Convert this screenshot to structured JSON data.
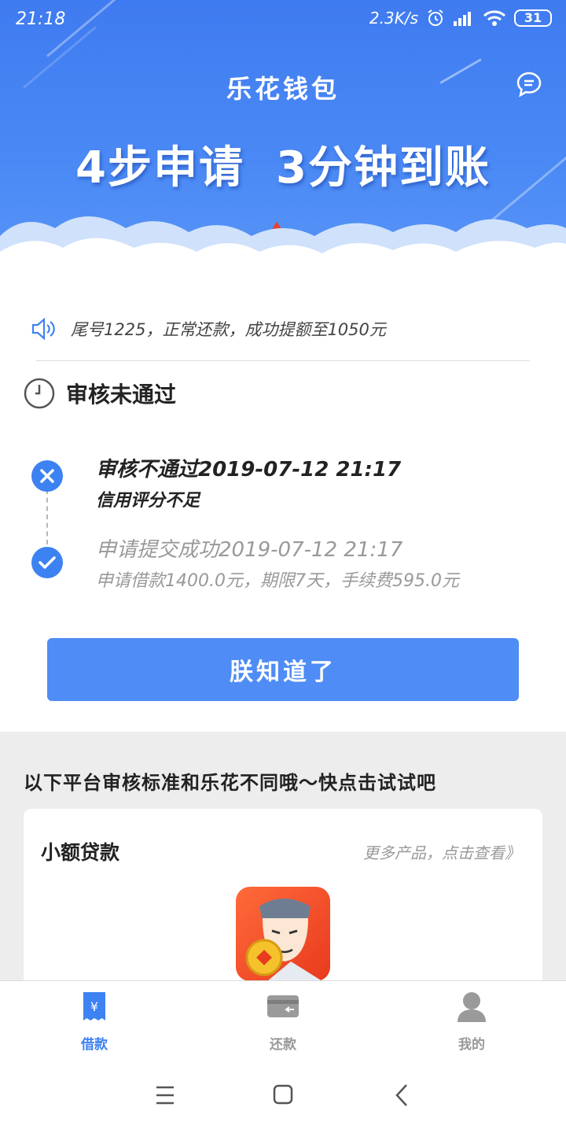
{
  "status_bar": {
    "time": "21:18",
    "speed": "2.3K/s",
    "battery": "31"
  },
  "header": {
    "app_title": "乐花钱包",
    "slogan_part1": "4步申请",
    "slogan_part2": "3分钟到账"
  },
  "notice": {
    "text": "尾号1225，正常还款，成功提额至1050元"
  },
  "review": {
    "title": "审核未通过",
    "steps": [
      {
        "title": "审核不通过2019-07-12  21:17",
        "subtitle": "信用评分不足"
      },
      {
        "title": "申请提交成功2019-07-12  21:17",
        "subtitle": "申请借款1400.0元，期限7天，手续费595.0元"
      }
    ]
  },
  "confirm_button": "朕知道了",
  "recommend": {
    "title": "以下平台审核标准和乐花不同哦～快点击试试吧",
    "card_title": "小额贷款",
    "more_link": "更多产品，点击查看》"
  },
  "bottom_nav": [
    {
      "label": "借款",
      "icon": "loan-icon",
      "active": true
    },
    {
      "label": "还款",
      "icon": "repay-card-icon",
      "active": false
    },
    {
      "label": "我的",
      "icon": "user-icon",
      "active": false
    }
  ],
  "colors": {
    "brand_blue": "#3d82f2",
    "button_blue": "#4f8cf5",
    "header_blue": "#4a89f5"
  }
}
